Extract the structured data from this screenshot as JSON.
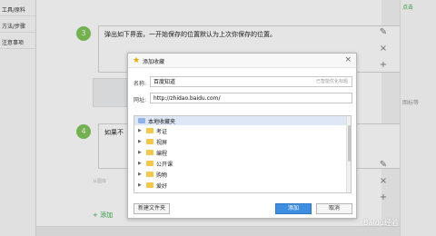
{
  "nav": {
    "items": [
      "工具/原料",
      "方法/步骤",
      "注意事项"
    ]
  },
  "right": {
    "top_text": "点击",
    "hint": "图标等"
  },
  "steps": {
    "step3": {
      "num": "3",
      "text": "弹出如下界面，一开始保存的位置默认为上次你保存的位置。"
    },
    "step4": {
      "num": "4",
      "text": "如果不"
    }
  },
  "controls": {
    "close": "×",
    "add": "+"
  },
  "ghost_text": "从图库",
  "add_step": "+ 添加",
  "dialog": {
    "title": "添加收藏",
    "close": "×",
    "name_label": "名称:",
    "name_value": "百度知道",
    "name_tip": "已智能优化标题",
    "url_label": "网址:",
    "url_value": "http://zhidao.baidu.com/",
    "tree": {
      "root": "本地收藏夹",
      "folders": [
        "考证",
        "视屏",
        "编程",
        "公开课",
        "购物",
        "爱好"
      ]
    },
    "new_folder_button": "新建文件夹",
    "add_button": "添加",
    "cancel_button": "取消"
  },
  "watermark": "Baidu经验",
  "colors": {
    "accent": "#7fc45a",
    "primary": "#3d8ee0"
  }
}
